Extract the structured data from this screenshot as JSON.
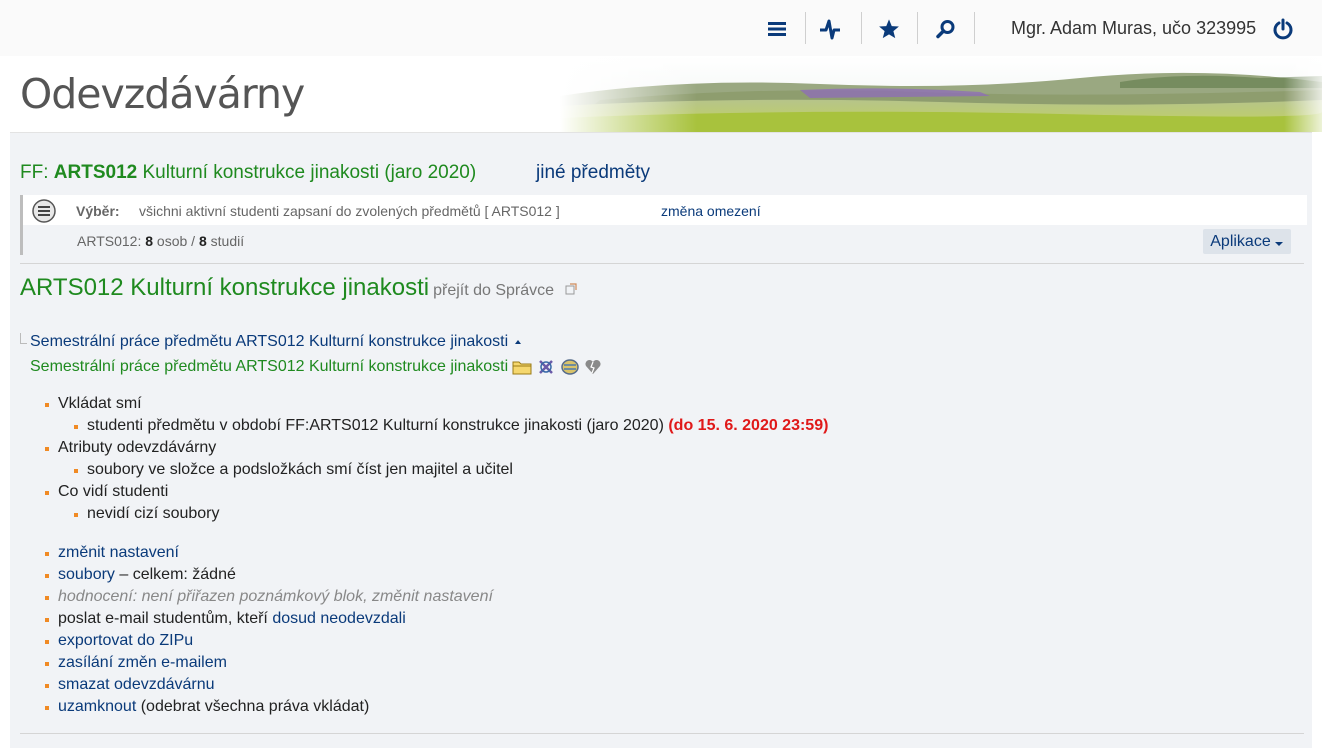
{
  "topbar": {
    "menu_icon": "hamburger-icon",
    "activity_icon": "pulse-icon",
    "favorites_icon": "star-icon",
    "search_icon": "search-icon",
    "user_name": "Mgr. Adam Muras, učo 323995",
    "logout_icon": "power-icon"
  },
  "banner": {
    "title": "Odevzdávárny"
  },
  "course": {
    "faculty_prefix": "FF: ",
    "code": "ARTS012",
    "name_term": " Kulturní konstrukce jinakosti (jaro 2020)",
    "other_subjects": "jiné předměty"
  },
  "filter": {
    "label": "Výběr:",
    "text": "všichni aktivní studenti zapsaní do zvolených předmětů [ ARTS012 ]",
    "change_link": "změna omezení",
    "counts_prefix": "ARTS012: ",
    "persons": "8",
    "persons_label": " osob / ",
    "studies": "8",
    "studies_label": " studií",
    "apps_button": "Aplikace"
  },
  "section": {
    "title": "ARTS012 Kulturní konstrukce jinakosti",
    "goto_admin": "přejít do Správce"
  },
  "folder": {
    "parent": "Semestrální práce předmětu ARTS012 Kulturní konstrukce jinakosti",
    "current": "Semestrální práce předmětu ARTS012 Kulturní konstrukce jinakosti"
  },
  "properties": {
    "insert_heading": "Vkládat smí",
    "insert_value": "studenti předmětu v období FF:ARTS012 Kulturní konstrukce jinakosti (jaro 2020) ",
    "insert_deadline": "(do 15. 6. 2020 23:59)",
    "attr_heading": "Atributy odevzdávárny",
    "attr_value": "soubory ve složce a podsložkách smí číst jen majitel a učitel",
    "students_heading": "Co vidí studenti",
    "students_value": "nevidí cizí soubory"
  },
  "actions": {
    "change_settings": "změnit nastavení",
    "files_link": "soubory",
    "files_rest": " – celkem: žádné",
    "grading": "hodnocení: není přiřazen poznámkový blok, změnit nastavení",
    "email_prefix": "poslat e-mail studentům, kteří ",
    "email_link": "dosud neodevzdali",
    "export_zip": "exportovat do ZIPu",
    "email_changes": "zasílání změn e-mailem",
    "delete": "smazat odevzdávárnu",
    "lock_link": "uzamknout",
    "lock_rest": " (odebrat všechna práva vkládat)"
  }
}
